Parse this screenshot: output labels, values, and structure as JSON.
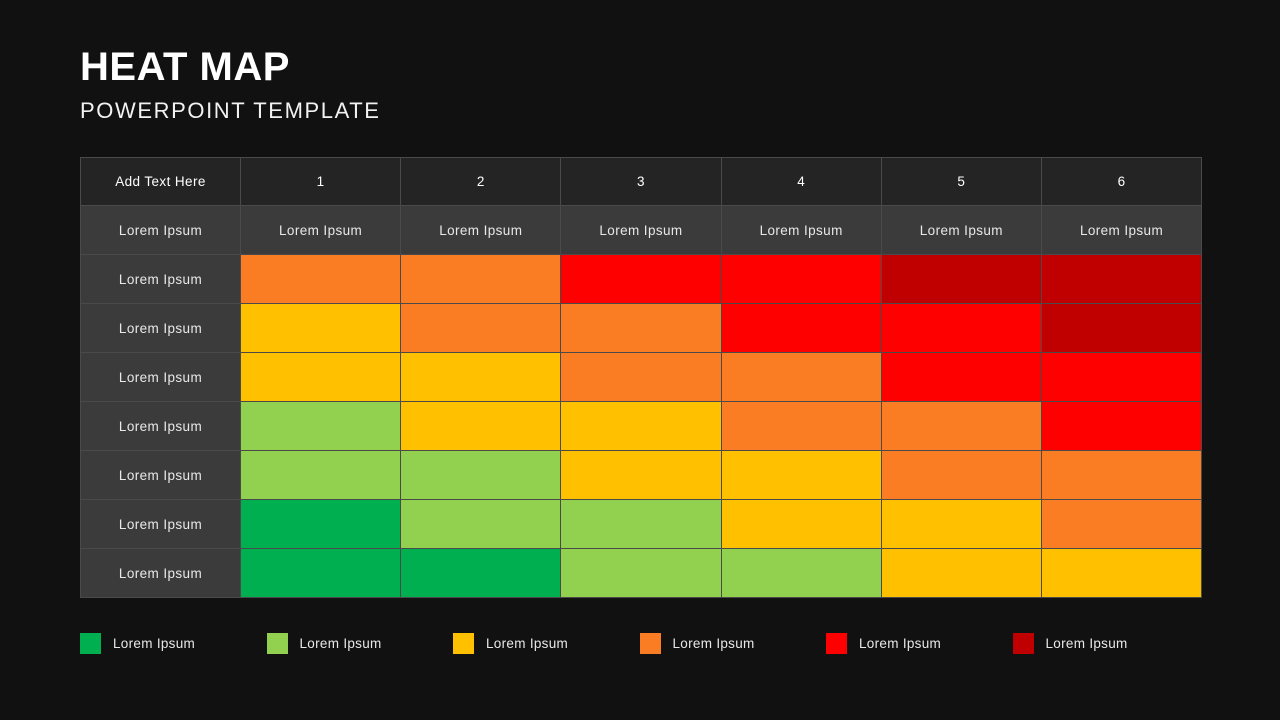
{
  "header": {
    "title": "HEAT MAP",
    "subtitle": "POWERPOINT TEMPLATE"
  },
  "palette": {
    "background": "#111111",
    "header_cell": "#242424",
    "label_cell": "#3b3b3b",
    "grid_line": "#4a4a4a",
    "green": "#00B050",
    "light_green": "#92D050",
    "yellow": "#FFC000",
    "orange": "#FA7D23",
    "red": "#FF0000",
    "dark_red": "#C00000"
  },
  "table": {
    "corner_label": "Add Text Here",
    "column_headers": [
      "1",
      "2",
      "3",
      "4",
      "5",
      "6"
    ],
    "subheader_row": [
      "Lorem Ipsum",
      "Lorem Ipsum",
      "Lorem Ipsum",
      "Lorem Ipsum",
      "Lorem Ipsum",
      "Lorem Ipsum",
      "Lorem Ipsum"
    ],
    "row_labels": [
      "Lorem Ipsum",
      "Lorem Ipsum",
      "Lorem Ipsum",
      "Lorem Ipsum",
      "Lorem Ipsum",
      "Lorem Ipsum",
      "Lorem Ipsum"
    ]
  },
  "legend": {
    "items": [
      {
        "label": "Lorem Ipsum",
        "color": "#00B050"
      },
      {
        "label": "Lorem Ipsum",
        "color": "#92D050"
      },
      {
        "label": "Lorem Ipsum",
        "color": "#FFC000"
      },
      {
        "label": "Lorem Ipsum",
        "color": "#FA7D23"
      },
      {
        "label": "Lorem Ipsum",
        "color": "#FF0000"
      },
      {
        "label": "Lorem Ipsum",
        "color": "#C00000"
      }
    ]
  },
  "chart_data": {
    "type": "heatmap",
    "title": "HEAT MAP",
    "subtitle": "POWERPOINT TEMPLATE",
    "xlabel": "",
    "ylabel": "",
    "categories_x": [
      "1",
      "2",
      "3",
      "4",
      "5",
      "6"
    ],
    "categories_y": [
      "Lorem Ipsum",
      "Lorem Ipsum",
      "Lorem Ipsum",
      "Lorem Ipsum",
      "Lorem Ipsum",
      "Lorem Ipsum",
      "Lorem Ipsum"
    ],
    "legend_position": "bottom",
    "grid": true,
    "color_scale": [
      {
        "level": 1,
        "name": "green",
        "hex": "#00B050",
        "legend_label": "Lorem Ipsum"
      },
      {
        "level": 2,
        "name": "light_green",
        "hex": "#92D050",
        "legend_label": "Lorem Ipsum"
      },
      {
        "level": 3,
        "name": "yellow",
        "hex": "#FFC000",
        "legend_label": "Lorem Ipsum"
      },
      {
        "level": 4,
        "name": "orange",
        "hex": "#FA7D23",
        "legend_label": "Lorem Ipsum"
      },
      {
        "level": 5,
        "name": "red",
        "hex": "#FF0000",
        "legend_label": "Lorem Ipsum"
      },
      {
        "level": 6,
        "name": "dark_red",
        "hex": "#C00000",
        "legend_label": "Lorem Ipsum"
      }
    ],
    "values": [
      [
        4,
        4,
        5,
        5,
        6,
        6
      ],
      [
        3,
        4,
        4,
        5,
        5,
        6
      ],
      [
        3,
        3,
        4,
        4,
        5,
        5
      ],
      [
        2,
        3,
        3,
        4,
        4,
        5
      ],
      [
        2,
        2,
        3,
        3,
        4,
        4
      ],
      [
        1,
        2,
        2,
        3,
        3,
        4
      ],
      [
        1,
        1,
        2,
        2,
        3,
        3
      ]
    ]
  }
}
